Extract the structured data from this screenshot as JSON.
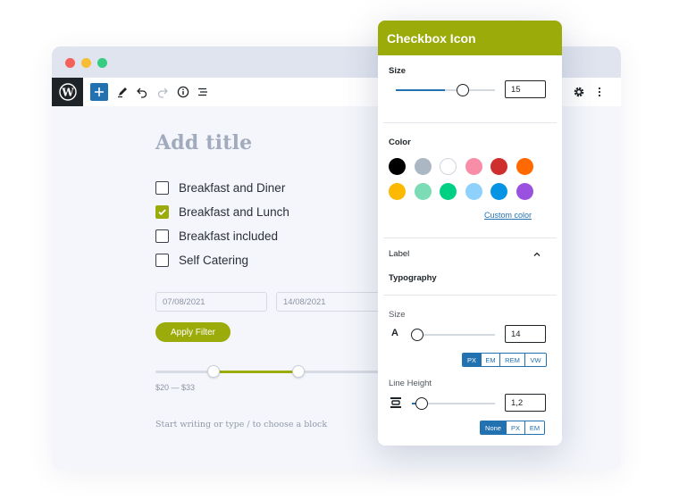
{
  "toolbar": {
    "add": "add",
    "edit": "edit",
    "undo": "undo",
    "redo": "redo",
    "info": "info",
    "list_view": "list-view",
    "settings": "settings",
    "more": "more"
  },
  "editor": {
    "title_placeholder": "Add title",
    "checkboxes": [
      {
        "label": "Breakfast and Diner",
        "checked": false
      },
      {
        "label": "Breakfast and Lunch",
        "checked": true
      },
      {
        "label": "Breakfast included",
        "checked": false
      },
      {
        "label": "Self Catering",
        "checked": false
      }
    ],
    "date_from": "07/08/2021",
    "date_to": "14/08/2021",
    "apply_button": "Apply Filter",
    "range_label": "$20 — $33",
    "block_placeholder": "Start writing or type / to choose a block"
  },
  "panel": {
    "title": "Checkbox Icon",
    "size_label": "Size",
    "size_value": "15",
    "color_label": "Color",
    "colors": [
      "#000000",
      "#abb8c3",
      "#ffffff",
      "#f78da7",
      "#cf2e2e",
      "#ff6900",
      "#fcb900",
      "#7bdcb5",
      "#00d084",
      "#8ed1fc",
      "#0693e3",
      "#9b51e0"
    ],
    "custom_color": "Custom color",
    "label_section": "Label",
    "typography_label": "Typography",
    "font_size_label": "Size",
    "font_size_icon": "A",
    "font_size_value": "14",
    "font_units": [
      "PX",
      "EM",
      "REM",
      "VW"
    ],
    "font_unit_active": 0,
    "line_height_label": "Line Height",
    "line_height_value": "1,2",
    "lh_units": [
      "None",
      "PX",
      "EM"
    ],
    "lh_unit_active": 0
  },
  "colors": {
    "accent": "#9aab0a",
    "wp_blue": "#2271b1",
    "wp_dark": "#1e2327"
  }
}
